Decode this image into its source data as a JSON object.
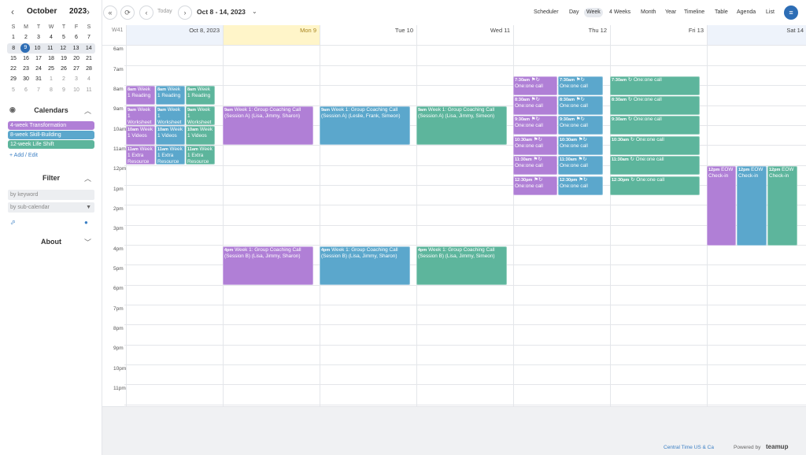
{
  "mini_calendar": {
    "prev": "‹",
    "next": "›",
    "month": "October",
    "year": "2023",
    "weekday_headers": [
      "S",
      "M",
      "T",
      "W",
      "T",
      "F",
      "S"
    ],
    "weeks": [
      [
        "1",
        "2",
        "3",
        "4",
        "5",
        "6",
        "7"
      ],
      [
        "8",
        "9",
        "10",
        "11",
        "12",
        "13",
        "14"
      ],
      [
        "15",
        "16",
        "17",
        "18",
        "19",
        "20",
        "21"
      ],
      [
        "22",
        "23",
        "24",
        "25",
        "26",
        "27",
        "28"
      ],
      [
        "29",
        "30",
        "31",
        "1",
        "2",
        "3",
        "4"
      ],
      [
        "5",
        "6",
        "7",
        "8",
        "9",
        "10",
        "11"
      ]
    ]
  },
  "sidebar": {
    "calendars_title": "Calendars",
    "calendars": [
      {
        "name": "4-week Transformation",
        "color": "#b07fd6"
      },
      {
        "name": "8-week Skill-Building",
        "color": "#5ba7cc"
      },
      {
        "name": "12-week Life Shift",
        "color": "#5db59c"
      }
    ],
    "add_edit": "+ Add / Edit",
    "filter_title": "Filter",
    "keyword_placeholder": "by keyword",
    "subcal_placeholder": "by sub-calendar",
    "about_title": "About"
  },
  "toolbar": {
    "today": "Today",
    "range": "Oct 8 - 14, 2023",
    "views": [
      "Scheduler",
      "Day",
      "Week",
      "4 Weeks",
      "Month",
      "Year",
      "Timeline",
      "Table",
      "Agenda",
      "List"
    ],
    "active_view": "Week"
  },
  "grid": {
    "week_label": "W41",
    "days": [
      "Oct 8, 2023",
      "Mon 9",
      "Tue 10",
      "Wed 11",
      "Thu 12",
      "Fri 13",
      "Sat 14"
    ],
    "hours": [
      "6am",
      "7am",
      "8am",
      "9am",
      "10am",
      "11am",
      "12pm",
      "1pm",
      "2pm",
      "3pm",
      "4pm",
      "5pm",
      "6pm",
      "7pm",
      "8pm",
      "9pm",
      "10pm",
      "11pm"
    ]
  },
  "events": {
    "sun_8_reading": {
      "time": "8am",
      "title": "Week 1 Reading"
    },
    "sun_9_worksheet": {
      "time": "9am",
      "title": "Week 1 Worksheet"
    },
    "sun_10_videos": {
      "time": "10am",
      "title": "Week 1 Videos"
    },
    "sun_11_extra": {
      "time": "11am",
      "title": "Week 1 Extra Resource"
    },
    "mon_9": {
      "time": "9am",
      "title": "Week 1: Group Coaching Call (Session A) (Lisa, Jimmy, Sharon)"
    },
    "tue_9": {
      "time": "9am",
      "title": "Week 1: Group Coaching Call (Session A) (Leslie, Frank, Simeon)"
    },
    "wed_9": {
      "time": "9am",
      "title": "Week 1: Group Coaching Call (Session A) (Lisa, Jimmy, Simeon)"
    },
    "mon_4": {
      "time": "4pm",
      "title": "Week 1: Group Coaching Call (Session B) (Lisa, Jimmy, Sharon)"
    },
    "tue_4": {
      "time": "4pm",
      "title": "Week 1: Group Coaching Call (Session B) (Lisa, Jimmy, Sharon)"
    },
    "wed_4": {
      "time": "4pm",
      "title": "Week 1: Group Coaching Call (Session B) (Lisa, Jimmy, Simeon)"
    },
    "one_on_one": "One:one call",
    "one_on_one_times": [
      "7:30am",
      "8:30am",
      "9:30am",
      "10:30am",
      "11:30am",
      "12:30pm"
    ],
    "sat_checkin": {
      "time": "12pm",
      "title": "EOW Check-in"
    }
  },
  "footer": {
    "timezone": "Central Time US & Ca",
    "powered": "Powered by",
    "brand": "teamup"
  }
}
